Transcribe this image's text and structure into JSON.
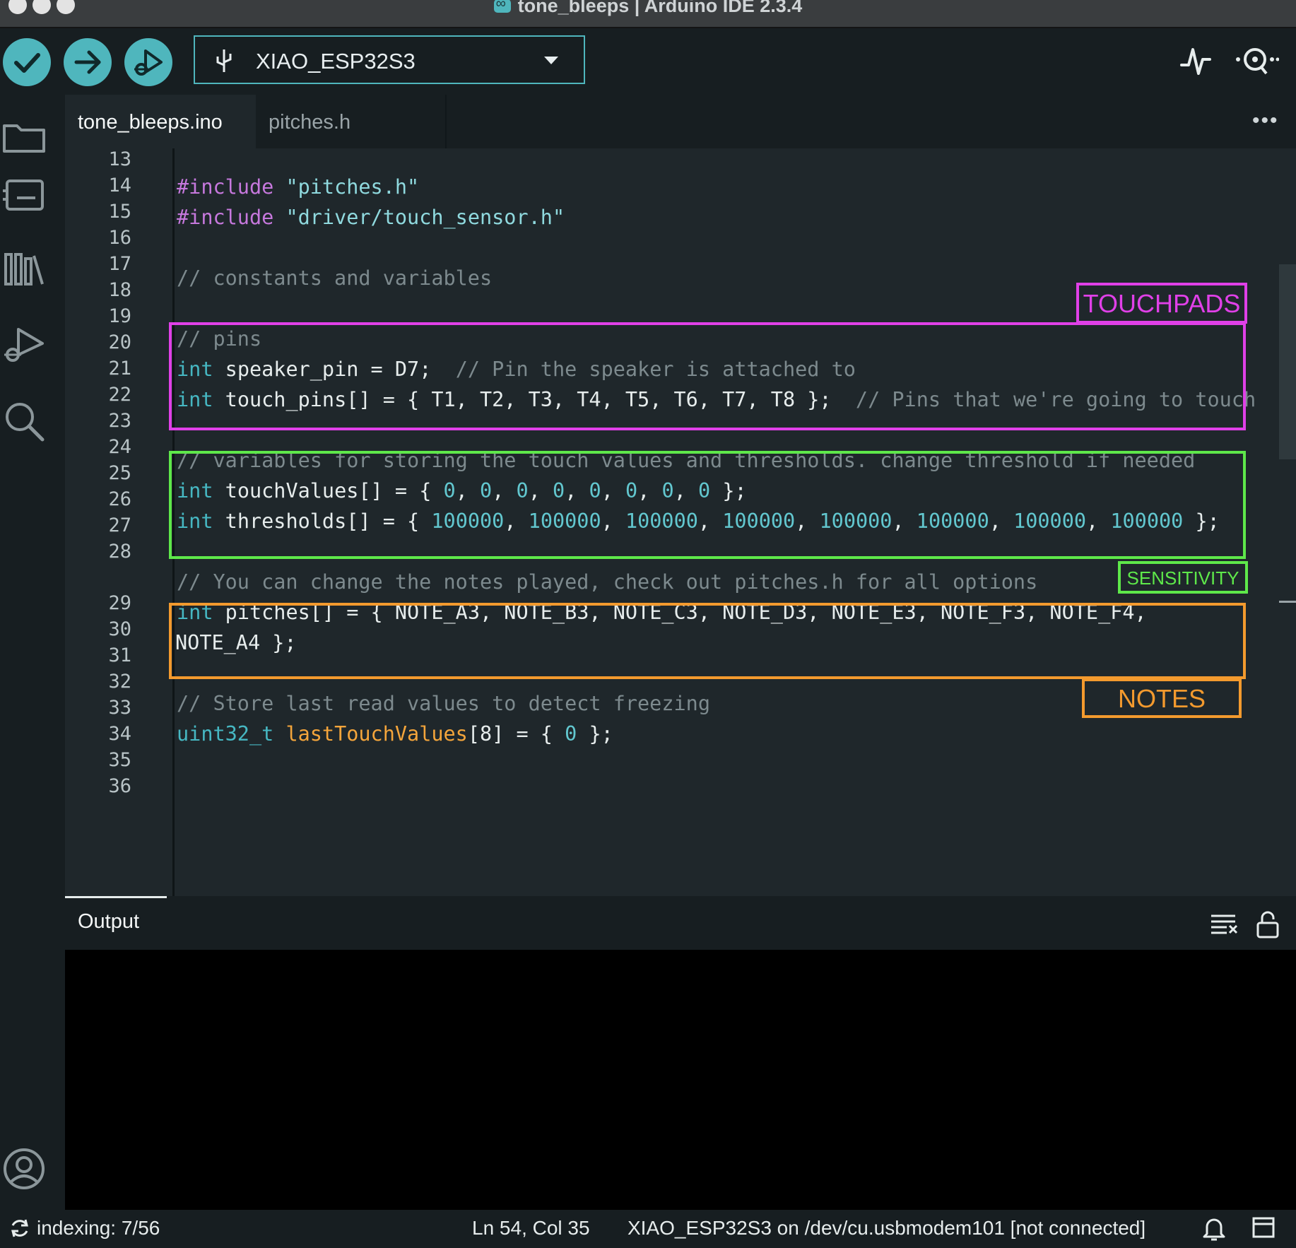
{
  "window": {
    "title": "tone_bleeps | Arduino IDE 2.3.4"
  },
  "toolbar": {
    "verify_icon": "checkmark-icon",
    "upload_icon": "arrow-right-icon",
    "debug_icon": "debug-icon",
    "board": "XIAO_ESP32S3",
    "serial_plotter_icon": "pulse-icon",
    "serial_monitor_icon": "magnifier-dots-icon"
  },
  "tabs": [
    {
      "label": "tone_bleeps.ino",
      "active": true
    },
    {
      "label": "pitches.h",
      "active": false
    }
  ],
  "editor": {
    "lines": [
      {
        "n": "13"
      },
      {
        "n": "14"
      },
      {
        "n": "15"
      },
      {
        "n": "16"
      },
      {
        "n": "17"
      },
      {
        "n": "18"
      },
      {
        "n": "19"
      },
      {
        "n": "20"
      },
      {
        "n": "21"
      },
      {
        "n": "22"
      },
      {
        "n": "23"
      },
      {
        "n": "24"
      },
      {
        "n": "25"
      },
      {
        "n": "26"
      },
      {
        "n": "27"
      },
      {
        "n": "28"
      },
      {
        "n": "29"
      },
      {
        "n": "30"
      },
      {
        "n": "31"
      },
      {
        "n": "32"
      },
      {
        "n": "33"
      },
      {
        "n": "34"
      },
      {
        "n": "35"
      },
      {
        "n": "36"
      }
    ],
    "code": {
      "l14_kw": "#include",
      "l14_str": "\"pitches.h\"",
      "l15_kw": "#include",
      "l15_str": "\"driver/touch_sensor.h\"",
      "l17": "// constants and variables",
      "l19": "// pins",
      "l20_ty": "int",
      "l20_body": "speaker_pin = D7;",
      "l20_cm": "// Pin the speaker is attached to",
      "l21_ty": "int",
      "l21_body": "touch_pins[] = { T1, T2, T3, T4, T5, T6, T7, T8 };",
      "l21_cm": "// Pins that we're going to touch",
      "l23": "// variables for storing the touch values and thresholds. change threshold if needed",
      "l24_ty": "int",
      "l24_name": "touchValues[] = {",
      "l24_vals": [
        "0",
        "0",
        "0",
        "0",
        "0",
        "0",
        "0",
        "0"
      ],
      "l24_end": "};",
      "l25_ty": "int",
      "l25_name": "thresholds[] = {",
      "l25_vals": [
        "100000",
        "100000",
        "100000",
        "100000",
        "100000",
        "100000",
        "100000",
        "100000"
      ],
      "l25_end": "};",
      "l27": "// You can change the notes played, check out pitches.h for all options",
      "l28_ty": "int",
      "l28_body": "pitches[] = { NOTE_A3, NOTE_B3, NOTE_C3, NOTE_D3, NOTE_E3, NOTE_F3, NOTE_F4,",
      "l28_wrap": "NOTE_A4 };",
      "l30": "// Store last read values to detect freezing",
      "l31_ty": "uint32_t",
      "l31_fn": "lastTouchValues",
      "l31_rest": "[8] = {",
      "l31_num": "0",
      "l31_end": "};"
    }
  },
  "annotations": [
    {
      "label": "TOUCHPADS",
      "color": "#e040e8"
    },
    {
      "label": "SENSITIVITY",
      "color": "#5ee84a"
    },
    {
      "label": "NOTES",
      "color": "#f39a2e"
    }
  ],
  "output": {
    "title": "Output",
    "clear_icon": "clear-output-icon",
    "lock_icon": "unlock-icon"
  },
  "status": {
    "indexing": "indexing: 7/56",
    "position": "Ln 54, Col 35",
    "connection": "XIAO_ESP32S3 on /dev/cu.usbmodem101 [not connected]",
    "notification_icon": "bell-icon",
    "panel_icon": "toggle-panel-icon"
  },
  "colors": {
    "accent": "#4fb6bd",
    "editor_bg": "#1f272b",
    "chrome_bg": "#171e21",
    "keyword": "#c678dd",
    "string": "#8fd9de",
    "comment": "#7d8a8e",
    "type": "#46b7c2",
    "function": "#f4a53b"
  }
}
